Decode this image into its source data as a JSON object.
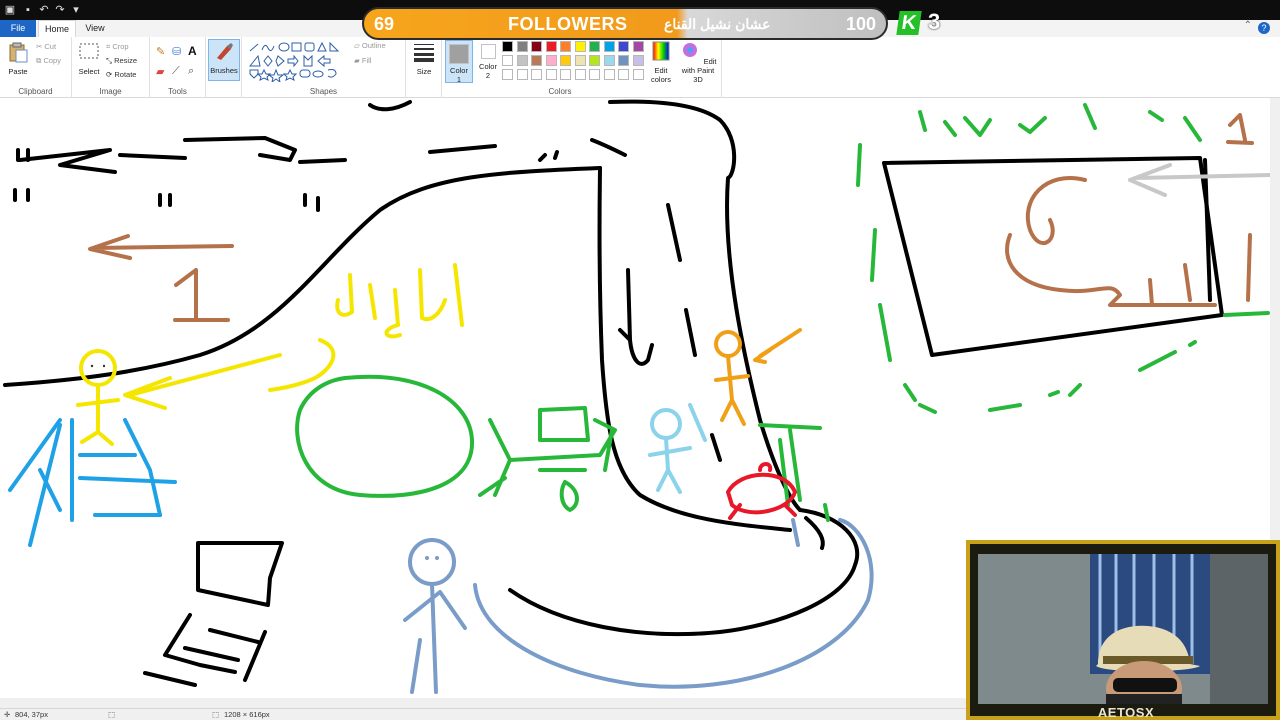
{
  "titlebar": {
    "quick_access": [
      "paint-app-icon",
      "save-icon",
      "undo-icon",
      "redo-icon",
      "customize-icon"
    ]
  },
  "overlay": {
    "followers_current": "69",
    "arabic_text": "عشان نشيل القناع",
    "followers_label": "FOLLOWERS",
    "followers_goal": "100",
    "kill_badge": "K",
    "kill_count": "3"
  },
  "menu": {
    "file": "File",
    "home": "Home",
    "view": "View"
  },
  "ribbon": {
    "clipboard": {
      "label": "Clipboard",
      "paste": "Paste",
      "cut": "Cut",
      "copy": "Copy"
    },
    "image": {
      "label": "Image",
      "select": "Select",
      "crop": "Crop",
      "resize": "Resize",
      "rotate": "Rotate"
    },
    "tools": {
      "label": "Tools"
    },
    "brushes": {
      "label": "Brushes"
    },
    "shapes": {
      "label": "Shapes",
      "outline": "Outline",
      "fill": "Fill"
    },
    "size": {
      "label": "Size"
    },
    "colors": {
      "label": "Colors",
      "color1": "Color",
      "color1_num": "1",
      "color2": "Color",
      "color2_num": "2",
      "edit_colors": "Edit colors",
      "edit_paint3d": "Edit with Paint 3D",
      "palette_row1": [
        "#000000",
        "#7f7f7f",
        "#880015",
        "#ed1c24",
        "#ff7f27",
        "#fff200",
        "#22b14c",
        "#00a2e8",
        "#3f48cc",
        "#a349a4"
      ],
      "palette_row2": [
        "#ffffff",
        "#c3c3c3",
        "#b97a57",
        "#ffaec9",
        "#ffc90e",
        "#efe4b0",
        "#b5e61d",
        "#99d9ea",
        "#7092be",
        "#c8bfe7"
      ],
      "active_color1": "#a0a0a0",
      "active_color2": "#ffffff"
    }
  },
  "canvas": {
    "arabic_word": "الناظر",
    "number_label": "1",
    "number_label_right": "1",
    "quote_marks": "\""
  },
  "statusbar": {
    "cursor_pos": "804, 37px",
    "canvas_size": "1208 × 616px"
  },
  "webcam": {
    "streamer_name": "AETOSX"
  }
}
